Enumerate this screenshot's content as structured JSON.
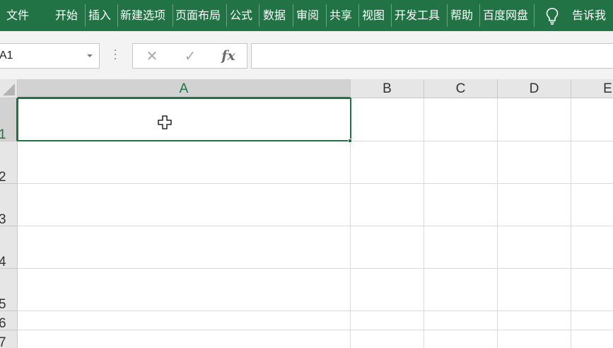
{
  "ribbon": {
    "tabs": [
      "文件",
      "开始",
      "插入",
      "新建选项",
      "页面布局",
      "公式",
      "数据",
      "审阅",
      "共享",
      "视图",
      "开发工具",
      "帮助",
      "百度网盘",
      "告诉我"
    ],
    "bg_color": "#217346",
    "tell_me_icon": "lightbulb-icon"
  },
  "formula_bar": {
    "name_box": "A1",
    "cancel_icon": "✕",
    "enter_icon": "✓",
    "function_icon": "fx",
    "value": ""
  },
  "sheet": {
    "columns": [
      "A",
      "B",
      "C",
      "D",
      "E"
    ],
    "rows": [
      "1",
      "2",
      "3",
      "4",
      "5",
      "6",
      "7"
    ],
    "active_cell": "A1",
    "selection_color": "#217346"
  }
}
